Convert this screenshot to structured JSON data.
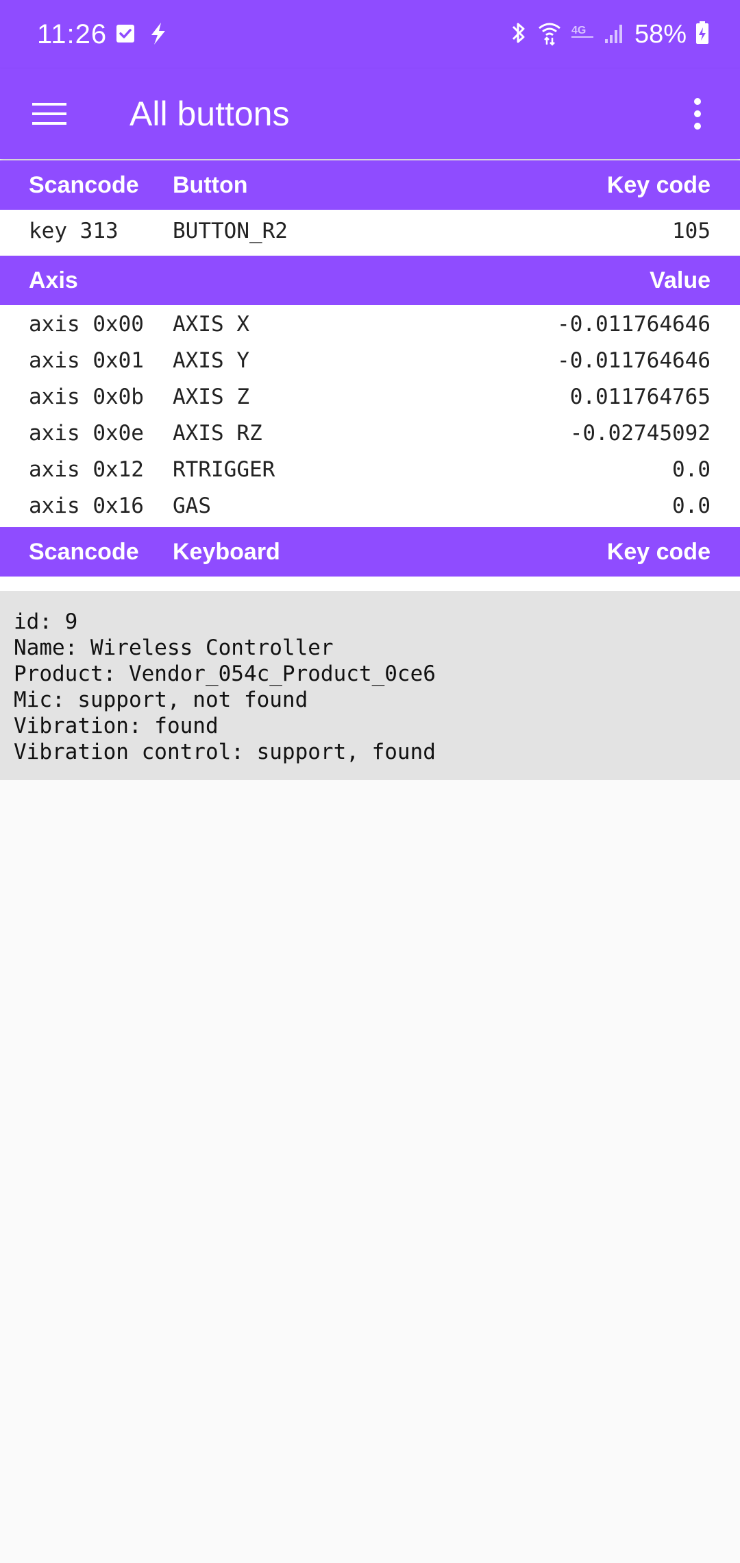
{
  "status_bar": {
    "time": "11:26",
    "battery": "58%",
    "icons": [
      "checkbox-icon",
      "charging-bolt-icon",
      "bluetooth-icon",
      "wifi-icon",
      "lte-icon",
      "signal-icon",
      "battery-icon"
    ]
  },
  "app_bar": {
    "title": "All buttons"
  },
  "buttons_section": {
    "headers": [
      "Scancode",
      "Button",
      "Key code"
    ],
    "rows": [
      {
        "scancode": "key 313",
        "button": "BUTTON_R2",
        "key_code": "105"
      }
    ]
  },
  "axis_section": {
    "headers": [
      "Axis",
      "Value"
    ],
    "rows": [
      {
        "code": "axis 0x00",
        "name": "AXIS X",
        "value": "-0.011764646"
      },
      {
        "code": "axis 0x01",
        "name": "AXIS Y",
        "value": "-0.011764646"
      },
      {
        "code": "axis 0x0b",
        "name": "AXIS Z",
        "value": "0.011764765"
      },
      {
        "code": "axis 0x0e",
        "name": "AXIS RZ",
        "value": "-0.02745092"
      },
      {
        "code": "axis 0x12",
        "name": "RTRIGGER",
        "value": "0.0"
      },
      {
        "code": "axis 0x16",
        "name": "GAS",
        "value": "0.0"
      }
    ]
  },
  "keyboard_section": {
    "headers": [
      "Scancode",
      "Keyboard",
      "Key code"
    ]
  },
  "device_info": {
    "lines": [
      "id: 9",
      "Name: Wireless Controller",
      "Product: Vendor_054c_Product_0ce6",
      "Mic: support, not found",
      "Vibration: found",
      "Vibration control: support, found"
    ]
  },
  "colors": {
    "accent": "#8f4cff",
    "info_bg": "#e3e3e3",
    "page_bg": "#fafafa"
  }
}
